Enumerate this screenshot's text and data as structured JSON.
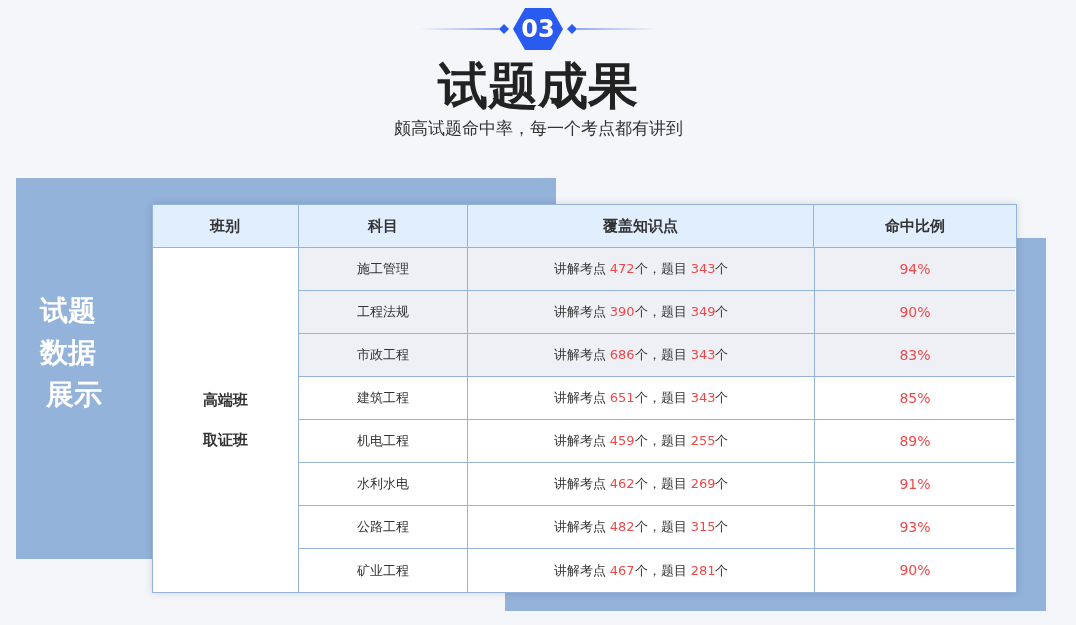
{
  "badge": "03",
  "title": "试题成果",
  "subtitle": "颇高试题命中率，每一个考点都有讲到",
  "side_label": [
    "试题",
    "数据",
    "展示"
  ],
  "table": {
    "columns": [
      "班别",
      "科目",
      "覆盖知识点",
      "命中比例"
    ],
    "classes": [
      "高端班",
      "取证班"
    ],
    "rows": [
      {
        "subject": "施工管理",
        "shaded": true,
        "coverage": [
          {
            "kind": "label",
            "text": "讲解考点 "
          },
          {
            "kind": "number",
            "text": "472"
          },
          {
            "kind": "label",
            "text": "个，题目 "
          },
          {
            "kind": "number",
            "text": "343"
          },
          {
            "kind": "label",
            "text": "个"
          }
        ],
        "rate": "94%"
      },
      {
        "subject": "工程法规",
        "shaded": true,
        "coverage": [
          {
            "kind": "label",
            "text": "讲解考点 "
          },
          {
            "kind": "number",
            "text": "390"
          },
          {
            "kind": "label",
            "text": "个，题目 "
          },
          {
            "kind": "number",
            "text": "349"
          },
          {
            "kind": "label",
            "text": "个"
          }
        ],
        "rate": "90%"
      },
      {
        "subject": "市政工程",
        "shaded": true,
        "coverage": [
          {
            "kind": "label",
            "text": "讲解考点 "
          },
          {
            "kind": "number",
            "text": "686"
          },
          {
            "kind": "label",
            "text": "个，题目 "
          },
          {
            "kind": "number",
            "text": "343"
          },
          {
            "kind": "label",
            "text": "个"
          }
        ],
        "rate": "83%"
      },
      {
        "subject": "建筑工程",
        "shaded": false,
        "coverage": [
          {
            "kind": "label",
            "text": "讲解考点 "
          },
          {
            "kind": "number",
            "text": "651"
          },
          {
            "kind": "label",
            "text": "个，题目 "
          },
          {
            "kind": "number",
            "text": "343"
          },
          {
            "kind": "label",
            "text": "个"
          }
        ],
        "rate": "85%"
      },
      {
        "subject": "机电工程",
        "shaded": false,
        "coverage": [
          {
            "kind": "label",
            "text": "讲解考点 "
          },
          {
            "kind": "number",
            "text": "459"
          },
          {
            "kind": "label",
            "text": "个，题目 "
          },
          {
            "kind": "number",
            "text": "255"
          },
          {
            "kind": "label",
            "text": "个"
          }
        ],
        "rate": "89%"
      },
      {
        "subject": "水利水电",
        "shaded": false,
        "coverage": [
          {
            "kind": "label",
            "text": "讲解考点 "
          },
          {
            "kind": "number",
            "text": "462"
          },
          {
            "kind": "label",
            "text": "个，题目 "
          },
          {
            "kind": "number",
            "text": "269"
          },
          {
            "kind": "label",
            "text": "个"
          }
        ],
        "rate": "91%"
      },
      {
        "subject": "公路工程",
        "shaded": false,
        "coverage": [
          {
            "kind": "label",
            "text": "讲解考点 "
          },
          {
            "kind": "number",
            "text": "482"
          },
          {
            "kind": "label",
            "text": "个，题目 "
          },
          {
            "kind": "number",
            "text": "315"
          },
          {
            "kind": "label",
            "text": "个"
          }
        ],
        "rate": "93%"
      },
      {
        "subject": "矿业工程",
        "shaded": false,
        "coverage": [
          {
            "kind": "label",
            "text": "讲解考点 "
          },
          {
            "kind": "number",
            "text": "467"
          },
          {
            "kind": "label",
            "text": "个，题目 "
          },
          {
            "kind": "number",
            "text": "281"
          },
          {
            "kind": "label",
            "text": "个"
          }
        ],
        "rate": "90%"
      }
    ]
  }
}
